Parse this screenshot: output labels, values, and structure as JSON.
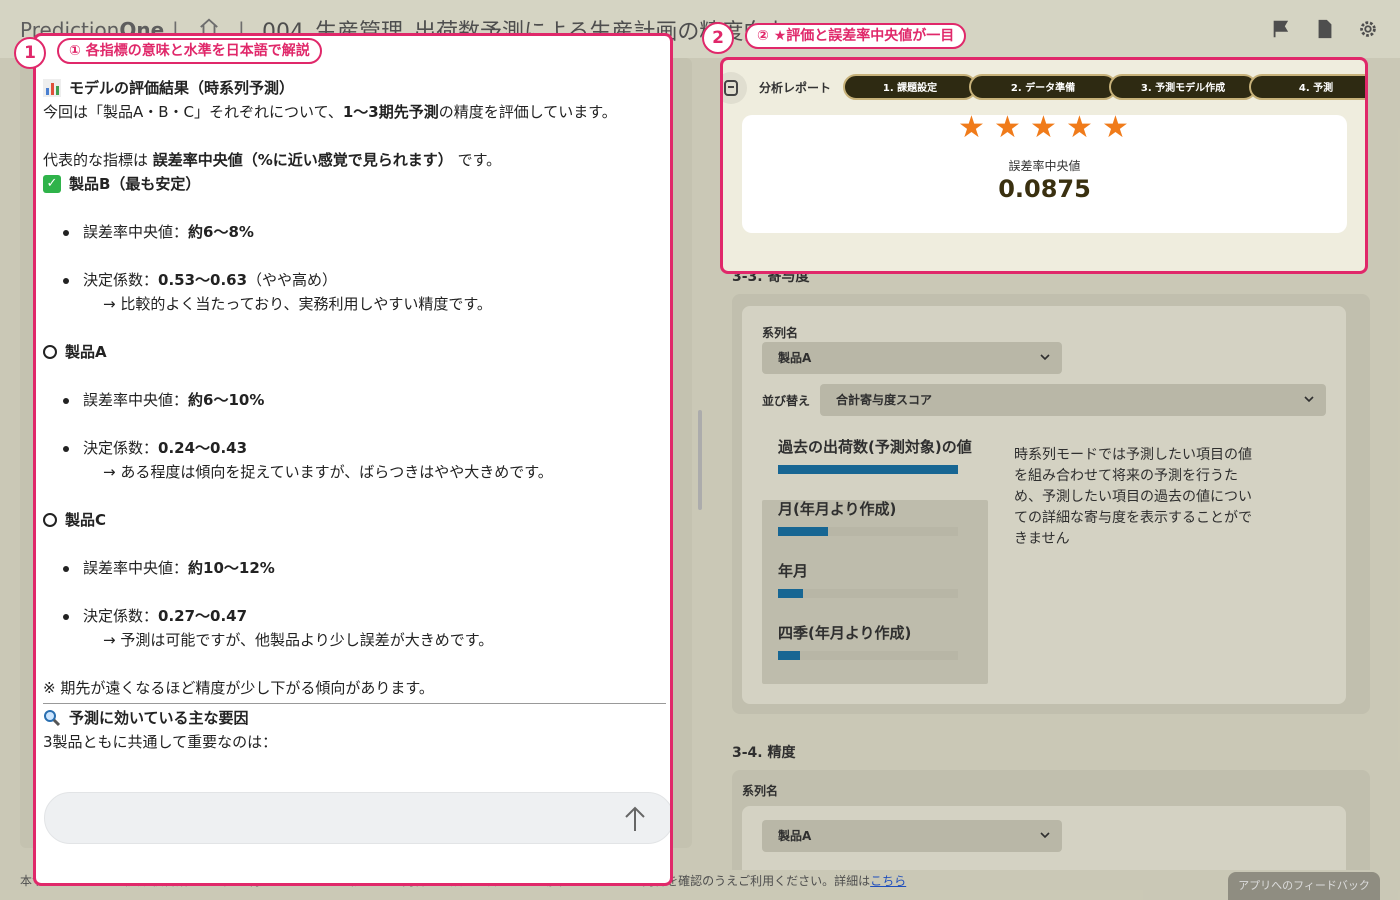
{
  "header": {
    "brand_prefix": "Prediction",
    "brand_suffix": "One",
    "separator": "|",
    "project_title": "004_生産管理_出荷数予測による生産計画の精度向上"
  },
  "callouts": {
    "c1": {
      "number": "1",
      "label": "① 各指標の意味と水準を日本語で解説"
    },
    "c2": {
      "number": "2",
      "label": "② ★評価と誤差率中央値が一目"
    }
  },
  "chat": {
    "title": "モデルの評価結果（時系列予測）",
    "intro_a": "今回は「製品A・B・C」それぞれについて、",
    "intro_b": "1〜3期先予測",
    "intro_c": "の精度を評価しています。",
    "indicator_a": "代表的な指標は ",
    "indicator_b": "誤差率中央値（%に近い感覚で見られます）",
    "indicator_c": " です。",
    "products": [
      {
        "name": "製品B（最も安定）",
        "icon": "check-icon",
        "err_label": "誤差率中央値：",
        "err_value": "約6〜8%",
        "r2_label": "決定係数：",
        "r2_value": "0.53〜0.63",
        "r2_note": "（やや高め）",
        "comment": "→ 比較的よく当たっており、実務利用しやすい精度です。"
      },
      {
        "name": "製品A",
        "icon": "circle-icon",
        "err_label": "誤差率中央値：",
        "err_value": "約6〜10%",
        "r2_label": "決定係数：",
        "r2_value": "0.24〜0.43",
        "r2_note": "",
        "comment": "→ ある程度は傾向を捉えていますが、ばらつきはやや大きめです。"
      },
      {
        "name": "製品C",
        "icon": "circle-icon",
        "err_label": "誤差率中央値：",
        "err_value": "約10〜12%",
        "r2_label": "決定係数：",
        "r2_value": "0.27〜0.47",
        "r2_note": "",
        "comment": "→ 予測は可能ですが、他製品より少し誤差が大きめです。"
      }
    ],
    "note": "※ 期先が遠くなるほど精度が少し下がる傾向があります。",
    "factors_title": "予測に効いている主な要因",
    "factors_intro": "3製品ともに共通して重要なのは："
  },
  "footer": {
    "note": "本サービスはLLM（大規模言語モデル）を利用しています。出力される内容には誤りが含まれる可能性があるため、内容を確認のうえご利用ください。詳細は",
    "link": "こちら",
    "feedback": "アプリへのフィードバック"
  },
  "report": {
    "label": "分析レポート",
    "steps": [
      "1. 課題設定",
      "2. データ準備",
      "3. 予測モデル作成",
      "4. 予測"
    ],
    "star_rating": 5,
    "metric_label": "誤差率中央値",
    "metric_value": "0.0875"
  },
  "contribution": {
    "section_title": "3-3. 寄与度",
    "series_label": "系列名",
    "series_value": "製品A",
    "sort_label": "並び替え",
    "sort_value": "合計寄与度スコア",
    "bars": [
      {
        "label": "過去の出荷数(予測対象)の値",
        "value": 1.0
      },
      {
        "label": "月(年月より作成)",
        "value": 0.28
      },
      {
        "label": "年月",
        "value": 0.14
      },
      {
        "label": "四季(年月より作成)",
        "value": 0.12
      }
    ],
    "info": "時系列モードでは予測したい項目の値を組み合わせて将来の予測を行うため、予測したい項目の過去の値についての詳細な寄与度を表示することができません"
  },
  "accuracy": {
    "section_title": "3-4. 精度",
    "series_label": "系列名",
    "series_value": "製品A"
  },
  "colors": {
    "highlight": "#e0286a",
    "star": "#f07b1a",
    "bar": "#1a6fa0"
  }
}
